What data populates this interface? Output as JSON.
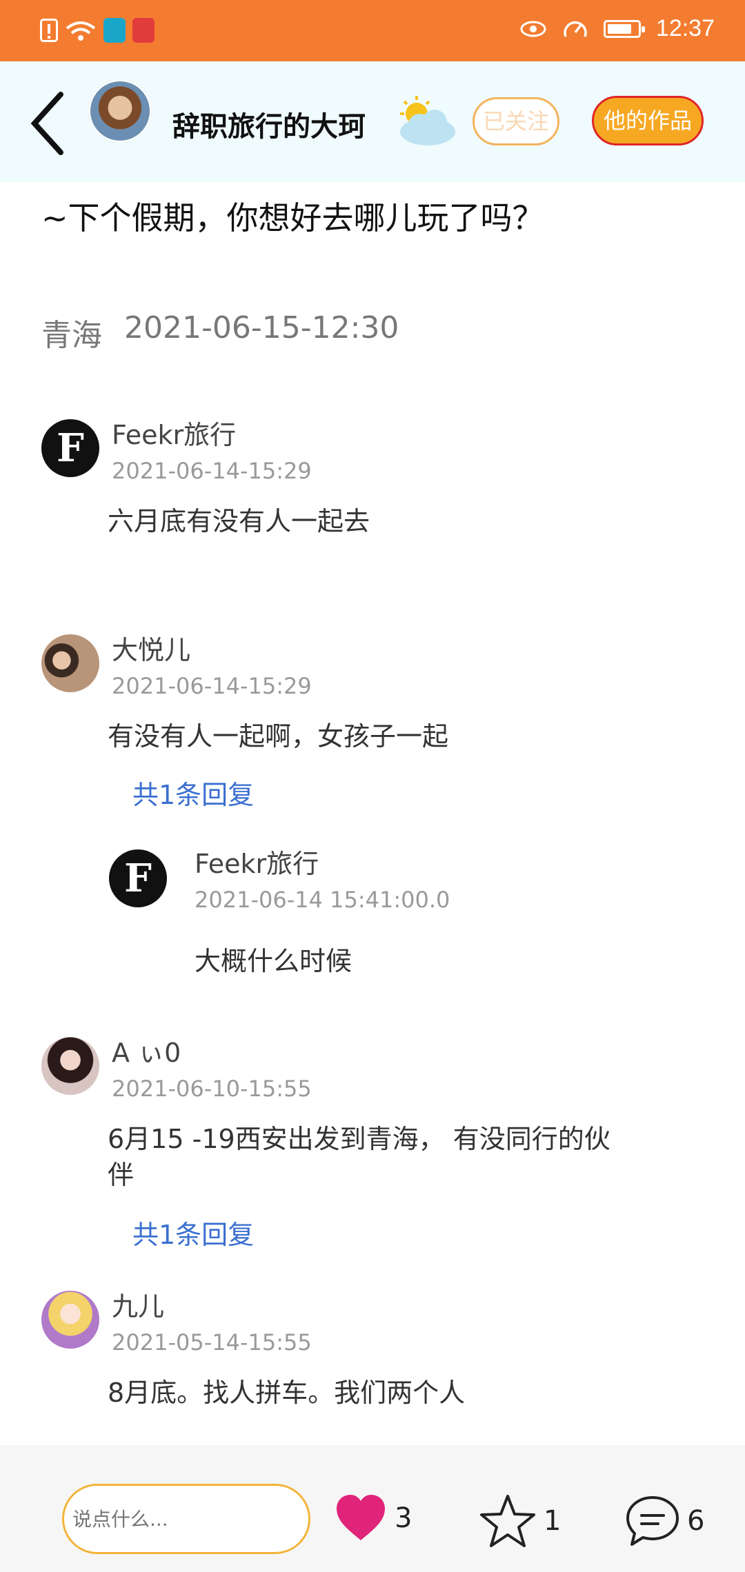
{
  "status_bar": {
    "time": "12:37"
  },
  "header": {
    "user_name": "辞职旅行的大珂",
    "follow_label": "已关注",
    "works_label": "他的作品"
  },
  "post": {
    "title": "~下个假期，你想好去哪儿玩了吗？",
    "location": "青海",
    "datetime": "2021-06-15-12:30"
  },
  "comments": [
    {
      "name": "Feekr旅行",
      "date": "2021-06-14-15:29",
      "text": "六月底有没有人一起去"
    },
    {
      "name": "大悦儿",
      "date": "2021-06-14-15:29",
      "text": "有没有人一起啊，女孩子一起",
      "reply_count": "共1条回复",
      "reply": {
        "name": "Feekr旅行",
        "date": "2021-06-14 15:41:00.0",
        "text": "大概什么时候"
      }
    },
    {
      "name": "A ぃ0",
      "date": "2021-06-10-15:55",
      "text_line1": "6月15 -19西安出发到青海， 有没同行的伙",
      "text_line2": "伴",
      "reply_count": "共1条回复"
    },
    {
      "name": "九儿",
      "date": "2021-05-14-15:55",
      "text": "8月底。找人拼车。我们两个人"
    }
  ],
  "bottom_bar": {
    "input_placeholder": "说点什么...",
    "likes": "3",
    "favorites": "1",
    "comments": "6"
  },
  "colors": {
    "accent": "#f47c30",
    "like": "#e0247a",
    "link": "#3a6fd0"
  }
}
